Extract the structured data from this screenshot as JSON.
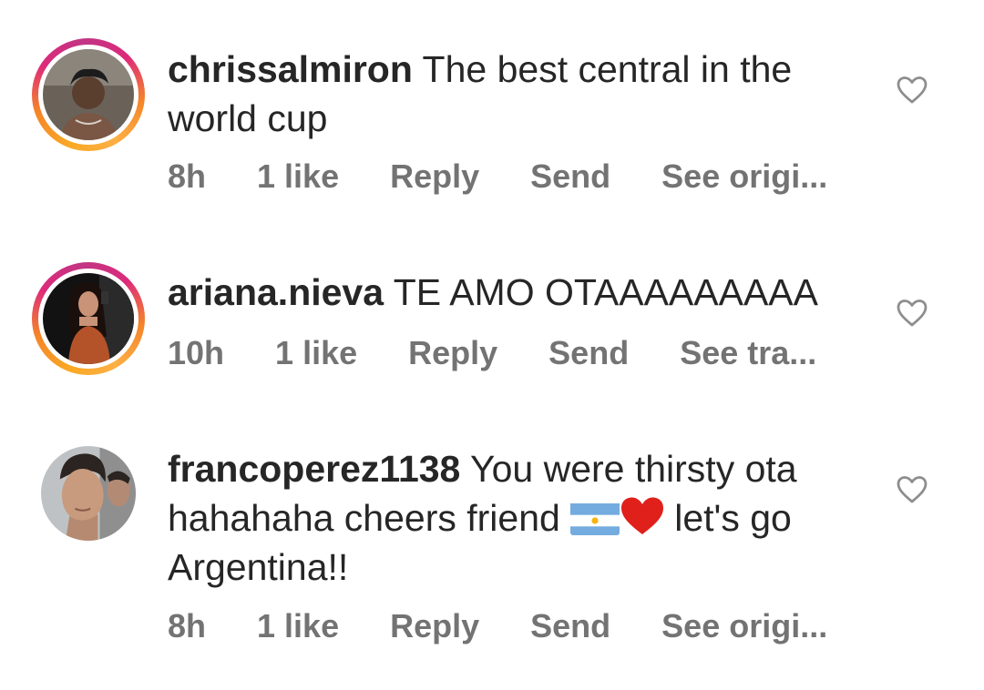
{
  "comments": [
    {
      "username": "chrissalmiron",
      "text": "The best central in the world cup",
      "time": "8h",
      "likes": "1 like",
      "reply": "Reply",
      "send": "Send",
      "translate": "See origi..."
    },
    {
      "username": "ariana.nieva",
      "text": "TE AMO OTAAAAAAAAA",
      "time": "10h",
      "likes": "1 like",
      "reply": "Reply",
      "send": "Send",
      "translate": "See tra..."
    },
    {
      "username": "francoperez1138",
      "text_before_emoji": "You were thirsty ota hahahaha cheers friend",
      "emoji_flag": "argentina-flag-icon",
      "emoji_heart": "red-heart-icon",
      "text_after_emoji": "let's go Argentina!!",
      "time": "8h",
      "likes": "1 like",
      "reply": "Reply",
      "send": "Send",
      "translate": "See origi..."
    }
  ],
  "colors": {
    "text": "#262626",
    "meta": "#737373",
    "heart_outline": "#8e8e8e",
    "story_ring": [
      "#f9a825",
      "#dd2a7b",
      "#c13584"
    ]
  }
}
